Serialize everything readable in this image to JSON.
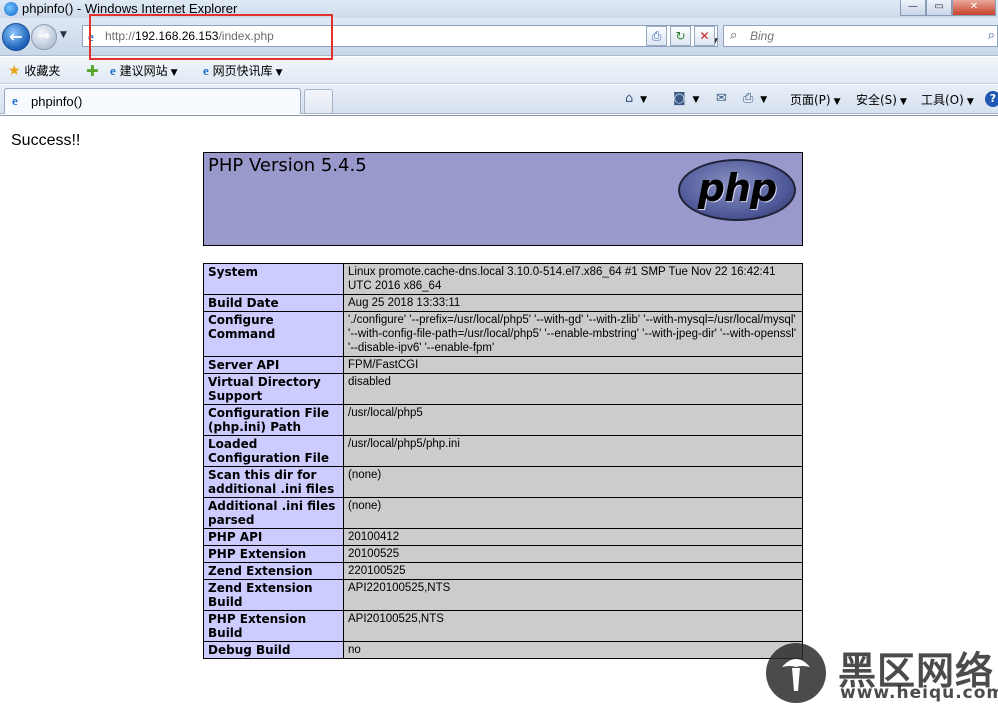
{
  "window": {
    "title": "phpinfo() - Windows Internet Explorer",
    "minimize_glyph": "—",
    "maximize_glyph": "▭",
    "close_glyph": "✕"
  },
  "nav": {
    "back_glyph": "←",
    "forward_glyph": "→",
    "address_prefix": "http://",
    "address_host": "192.168.26.153",
    "address_path": "/index.php",
    "search_placeholder": "Bing",
    "icons": [
      "ie-icon",
      "compat-view-icon",
      "refresh-icon",
      "stop-icon",
      "search-icon"
    ],
    "highlight_color": "#e2322d"
  },
  "favorites": {
    "label": "收藏夹",
    "items": [
      {
        "label": "建议网站"
      },
      {
        "label": "网页快讯库"
      }
    ]
  },
  "tab": {
    "label": "phpinfo()"
  },
  "commands": {
    "page": "页面(P)",
    "safety": "安全(S)",
    "tools": "工具(O)",
    "help": "?"
  },
  "content": {
    "success": "Success!!",
    "php_version": "PHP Version 5.4.5",
    "logo_text": "php",
    "header_color": "#9999cc",
    "label_color": "#ccccff",
    "value_color": "#cccccc",
    "rows": [
      {
        "label": "System",
        "value": "Linux promote.cache-dns.local 3.10.0-514.el7.x86_64 #1 SMP Tue Nov 22 16:42:41 UTC 2016 x86_64"
      },
      {
        "label": "Build Date",
        "value": "Aug 25 2018 13:33:11"
      },
      {
        "label": "Configure Command",
        "value": "'./configure' '--prefix=/usr/local/php5' '--with-gd' '--with-zlib' '--with-mysql=/usr/local/mysql' '--with-config-file-path=/usr/local/php5' '--enable-mbstring' '--with-jpeg-dir' '--with-openssl' '--disable-ipv6' '--enable-fpm'"
      },
      {
        "label": "Server API",
        "value": "FPM/FastCGI"
      },
      {
        "label": "Virtual Directory Support",
        "value": "disabled"
      },
      {
        "label": "Configuration File (php.ini) Path",
        "value": "/usr/local/php5"
      },
      {
        "label": "Loaded Configuration File",
        "value": "/usr/local/php5/php.ini"
      },
      {
        "label": "Scan this dir for additional .ini files",
        "value": "(none)"
      },
      {
        "label": "Additional .ini files parsed",
        "value": "(none)"
      },
      {
        "label": "PHP API",
        "value": "20100412"
      },
      {
        "label": "PHP Extension",
        "value": "20100525"
      },
      {
        "label": "Zend Extension",
        "value": "220100525"
      },
      {
        "label": "Zend Extension Build",
        "value": "API220100525,NTS"
      },
      {
        "label": "PHP Extension Build",
        "value": "API20100525,NTS"
      },
      {
        "label": "Debug Build",
        "value": "no"
      }
    ]
  },
  "watermark": {
    "cn": "黑区网络",
    "url": "www.heiqu.com"
  }
}
